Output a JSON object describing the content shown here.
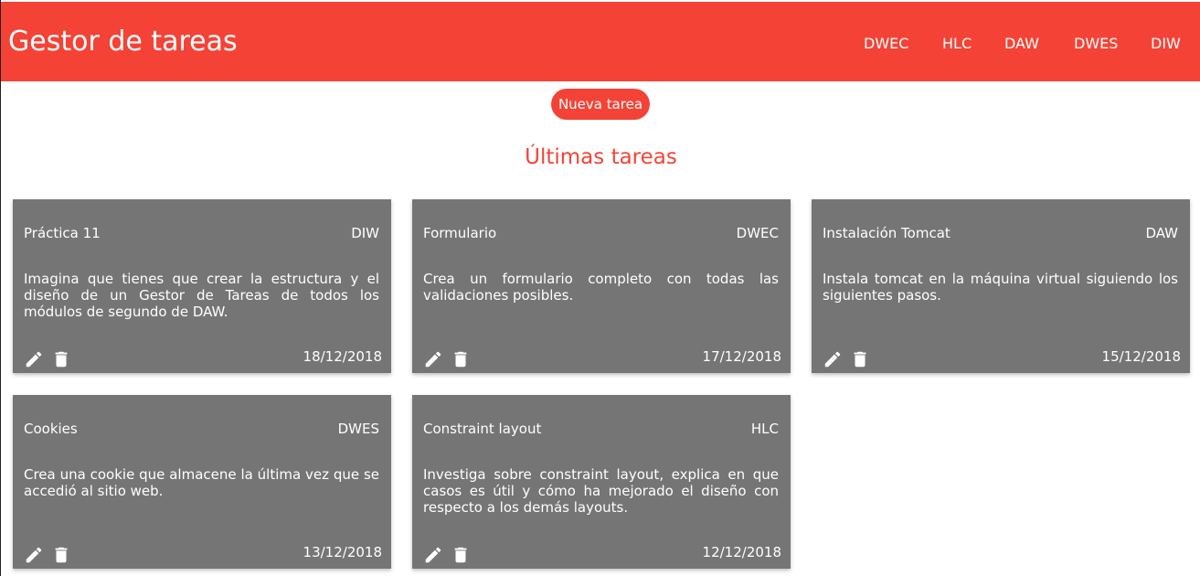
{
  "header": {
    "brand": "Gestor de tareas",
    "nav": [
      "DWEC",
      "HLC",
      "DAW",
      "DWES",
      "DIW"
    ]
  },
  "actions": {
    "new_task_label": "Nueva tarea"
  },
  "section": {
    "title": "Últimas tareas"
  },
  "colors": {
    "primary": "#f44336",
    "card_bg": "#757575",
    "text_light": "#ffffff"
  },
  "icons": {
    "edit": "pencil-icon",
    "delete": "trash-icon"
  },
  "tasks": [
    {
      "title": "Práctica 11",
      "subject": "DIW",
      "description": "Imagina que tienes que crear la estructura y el diseño de un Gestor de Tareas de todos los módulos de segundo de DAW.",
      "date": "18/12/2018"
    },
    {
      "title": "Formulario",
      "subject": "DWEC",
      "description": "Crea un formulario completo con todas las validaciones posibles.",
      "date": "17/12/2018"
    },
    {
      "title": "Instalación Tomcat",
      "subject": "DAW",
      "description": "Instala tomcat en la máquina virtual siguiendo los siguientes pasos.",
      "date": "15/12/2018"
    },
    {
      "title": "Cookies",
      "subject": "DWES",
      "description": "Crea una cookie que almacene la última vez que se accedió al sitio web.",
      "date": "13/12/2018"
    },
    {
      "title": "Constraint layout",
      "subject": "HLC",
      "description": "Investiga sobre constraint layout, explica en que casos es útil y cómo ha mejorado el diseño con respecto a los demás layouts.",
      "date": "12/12/2018"
    }
  ]
}
